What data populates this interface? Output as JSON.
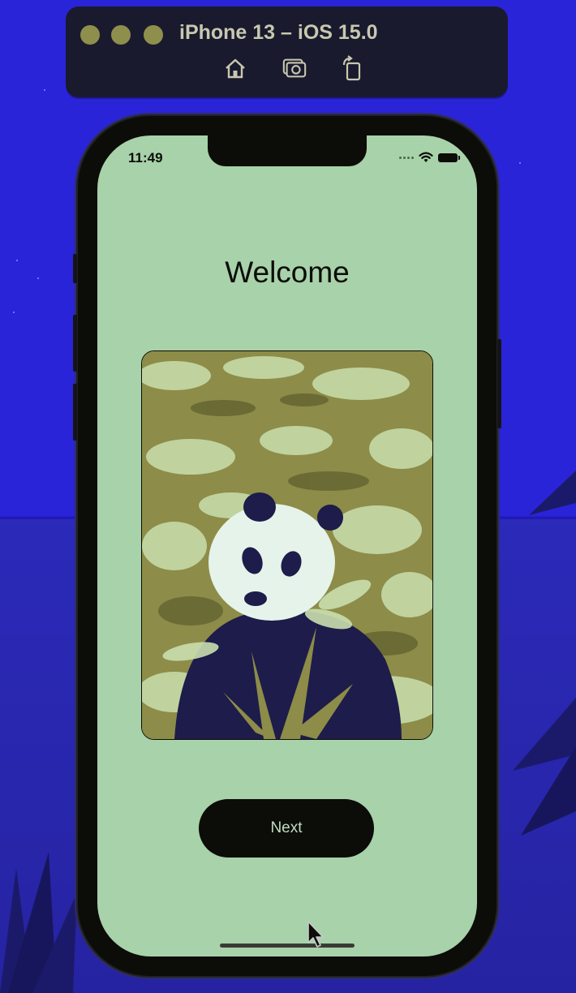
{
  "simulator": {
    "title": "iPhone 13 – iOS 15.0",
    "toolbar": {
      "home_icon": "home-icon",
      "screenshot_icon": "camera-icon",
      "rotate_icon": "rotate-icon"
    },
    "traffic_light_color": "#8f8f4d"
  },
  "status_bar": {
    "time": "11:49",
    "icons": [
      "cellular-icon",
      "wifi-icon",
      "battery-icon"
    ]
  },
  "screen": {
    "title": "Welcome",
    "image": "panda-photo",
    "next_label": "Next",
    "background_color": "#a8d2aa",
    "button_color": "#0c0c08"
  }
}
